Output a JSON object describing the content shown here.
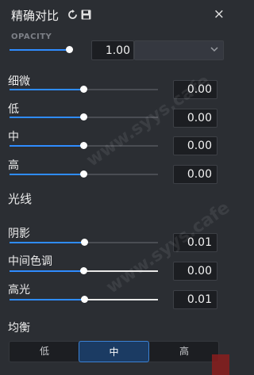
{
  "header": {
    "title": "精确对比",
    "icons": [
      "reset-icon",
      "save-icon",
      "close-icon"
    ],
    "close_glyph": "×"
  },
  "opacity": {
    "label": "OPACITY",
    "value": "1.00",
    "slider_level": 1.0
  },
  "tone_sliders": [
    {
      "label": "细微",
      "value": "0.00",
      "level": 0.5
    },
    {
      "label": "低",
      "value": "0.00",
      "level": 0.5
    },
    {
      "label": "中",
      "value": "0.00",
      "level": 0.5
    },
    {
      "label": "高",
      "value": "0.00",
      "level": 0.5
    }
  ],
  "light_section": {
    "title": "光线",
    "sliders": [
      {
        "label": "阴影",
        "value": "0.01",
        "level": 0.5
      },
      {
        "label": "中间色调",
        "value": "0.00",
        "level": 0.5
      },
      {
        "label": "高光",
        "value": "0.01",
        "level": 0.5
      }
    ]
  },
  "balance": {
    "title": "均衡",
    "options": [
      "低",
      "中",
      "高"
    ],
    "selected": "中"
  },
  "watermark": "www.syys.cafe",
  "colors": {
    "accent": "#2f8cff",
    "background": "#2b2e33",
    "field": "#1c1e22"
  }
}
